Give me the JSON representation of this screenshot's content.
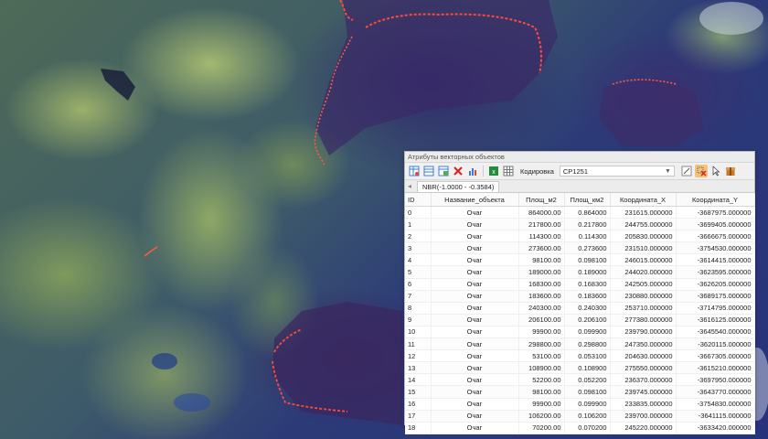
{
  "window": {
    "title": "Атрибуты векторных объектов",
    "encoding_label": "Кодировка",
    "encoding_value": "CP1251",
    "tab_label": "NBR(-1.0000 - -0.3584)",
    "toolbar_icons": [
      "table-icon",
      "table-edit-icon",
      "table-add-icon",
      "delete-icon",
      "chart-icon",
      "export-excel-icon",
      "grid-icon",
      "zoom-to-icon",
      "clear-selection-icon",
      "select-cursor-icon",
      "settings-box-icon"
    ]
  },
  "table": {
    "columns": [
      "ID",
      "Название_объекта",
      "Площ_м2",
      "Площ_км2",
      "Координата_X",
      "Координата_Y"
    ],
    "rows": [
      [
        "0",
        "Очаг",
        "864000.00",
        "0.864000",
        "231615.000000",
        "-3687975.000000"
      ],
      [
        "1",
        "Очаг",
        "217800.00",
        "0.217800",
        "244755.000000",
        "-3699405.000000"
      ],
      [
        "2",
        "Очаг",
        "114300.00",
        "0.114300",
        "205830.000000",
        "-3666675.000000"
      ],
      [
        "3",
        "Очаг",
        "273600.00",
        "0.273600",
        "231510.000000",
        "-3754530.000000"
      ],
      [
        "4",
        "Очаг",
        "98100.00",
        "0.098100",
        "246015.000000",
        "-3614415.000000"
      ],
      [
        "5",
        "Очаг",
        "189000.00",
        "0.189000",
        "244020.000000",
        "-3623595.000000"
      ],
      [
        "6",
        "Очаг",
        "168300.00",
        "0.168300",
        "242505.000000",
        "-3626205.000000"
      ],
      [
        "7",
        "Очаг",
        "183600.00",
        "0.183600",
        "230880.000000",
        "-3689175.000000"
      ],
      [
        "8",
        "Очаг",
        "240300.00",
        "0.240300",
        "253710.000000",
        "-3714795.000000"
      ],
      [
        "9",
        "Очаг",
        "206100.00",
        "0.206100",
        "277380.000000",
        "-3616125.000000"
      ],
      [
        "10",
        "Очаг",
        "99900.00",
        "0.099900",
        "239790.000000",
        "-3645540.000000"
      ],
      [
        "11",
        "Очаг",
        "298800.00",
        "0.298800",
        "247350.000000",
        "-3620115.000000"
      ],
      [
        "12",
        "Очаг",
        "53100.00",
        "0.053100",
        "204630.000000",
        "-3667305.000000"
      ],
      [
        "13",
        "Очаг",
        "108900.00",
        "0.108900",
        "275550.000000",
        "-3615210.000000"
      ],
      [
        "14",
        "Очаг",
        "52200.00",
        "0.052200",
        "236370.000000",
        "-3697950.000000"
      ],
      [
        "15",
        "Очаг",
        "98100.00",
        "0.098100",
        "239745.000000",
        "-3643770.000000"
      ],
      [
        "16",
        "Очаг",
        "99900.00",
        "0.099900",
        "233835.000000",
        "-3754830.000000"
      ],
      [
        "17",
        "Очаг",
        "106200.00",
        "0.106200",
        "239700.000000",
        "-3641115.000000"
      ],
      [
        "18",
        "Очаг",
        "70200.00",
        "0.070200",
        "245220.000000",
        "-3633420.000000"
      ]
    ]
  },
  "colors": {
    "fire_line": "#ff4a3a",
    "burned_area": "#3a2a62",
    "vegetation": "#8fa865",
    "water_dark": "#1b2550"
  }
}
